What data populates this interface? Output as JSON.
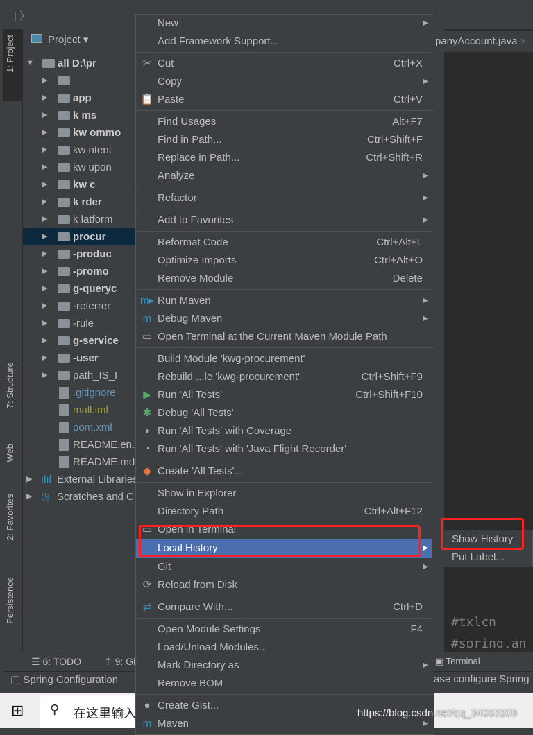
{
  "breadcrumb": "|  〉",
  "left_tabs": [
    "1: Project",
    "7: Structure",
    "Web",
    "2: Favorites",
    "Persistence"
  ],
  "project_header": "Project",
  "tree": [
    {
      "label": "all  D:\\pr",
      "expanded": true,
      "bold": true
    },
    {
      "label": "",
      "expanded": false
    },
    {
      "label": "app",
      "bold": true
    },
    {
      "label": "k    ms",
      "bold": true
    },
    {
      "label": "kw    ommo",
      "bold": true
    },
    {
      "label": "kw    ntent"
    },
    {
      "label": "kw    upon"
    },
    {
      "label": "kw    c",
      "bold": true
    },
    {
      "label": "k    rder",
      "bold": true
    },
    {
      "label": "k    latform"
    },
    {
      "label": "procur",
      "bold": true,
      "selected": true
    },
    {
      "label": "-produc",
      "bold": true
    },
    {
      "label": "-promo",
      "bold": true
    },
    {
      "label": "g-queryc",
      "bold": true
    },
    {
      "label": "-referrer"
    },
    {
      "label": "-rule"
    },
    {
      "label": "g-service",
      "bold": true
    },
    {
      "label": "-user",
      "bold": true
    },
    {
      "label": "path_IS_I"
    }
  ],
  "tree_files": [
    ".gitignore",
    "mall.iml",
    "pom.xml",
    "README.en.",
    "README.md"
  ],
  "external_libraries": "External Libraries",
  "scratches": "Scratches and C",
  "editor_tab": "panyAccount.java",
  "code_lines": [
    "#txlcn",
    "#spring.an"
  ],
  "bottom_tabs": [
    "6: TODO",
    "9: Gi",
    "Terminal"
  ],
  "status_left": "Spring Configuration",
  "status_right": "ase configure Spring",
  "taskbar_search": "在这里输入",
  "watermark": "https://blog.csdn.net/qq_34033209",
  "menu": [
    {
      "label": "New",
      "submenu": true
    },
    {
      "label": "Add Framework Support..."
    },
    {
      "sep": true
    },
    {
      "label": "Cut",
      "shortcut": "Ctrl+X",
      "icon": "scissors"
    },
    {
      "label": "Copy",
      "submenu": true
    },
    {
      "label": "Paste",
      "shortcut": "Ctrl+V",
      "icon": "clipboard"
    },
    {
      "sep": true
    },
    {
      "label": "Find Usages",
      "shortcut": "Alt+F7"
    },
    {
      "label": "Find in Path...",
      "shortcut": "Ctrl+Shift+F"
    },
    {
      "label": "Replace in Path...",
      "shortcut": "Ctrl+Shift+R"
    },
    {
      "label": "Analyze",
      "submenu": true
    },
    {
      "sep": true
    },
    {
      "label": "Refactor",
      "submenu": true
    },
    {
      "sep": true
    },
    {
      "label": "Add to Favorites",
      "submenu": true
    },
    {
      "sep": true
    },
    {
      "label": "Reformat Code",
      "shortcut": "Ctrl+Alt+L"
    },
    {
      "label": "Optimize Imports",
      "shortcut": "Ctrl+Alt+O"
    },
    {
      "label": "Remove Module",
      "shortcut": "Delete"
    },
    {
      "sep": true
    },
    {
      "label": "Run Maven",
      "submenu": true,
      "icon": "maven-run"
    },
    {
      "label": "Debug Maven",
      "submenu": true,
      "icon": "maven-debug"
    },
    {
      "label": "Open Terminal at the Current Maven Module Path",
      "icon": "maven-terminal"
    },
    {
      "sep": true
    },
    {
      "label": "Build Module 'kwg-procurement'"
    },
    {
      "label": "Rebuild ...le 'kwg-procurement'",
      "shortcut": "Ctrl+Shift+F9"
    },
    {
      "label": "Run 'All Tests'",
      "shortcut": "Ctrl+Shift+F10",
      "icon": "run"
    },
    {
      "label": "Debug 'All Tests'",
      "icon": "debug"
    },
    {
      "label": "Run 'All Tests' with Coverage",
      "icon": "coverage"
    },
    {
      "label": "Run 'All Tests' with 'Java Flight Recorder'",
      "icon": "profiler"
    },
    {
      "sep": true
    },
    {
      "label": "Create 'All Tests'...",
      "icon": "create-test"
    },
    {
      "sep": true
    },
    {
      "label": "Show in Explorer"
    },
    {
      "label": "Directory Path",
      "shortcut": "Ctrl+Alt+F12"
    },
    {
      "label": "Open in Terminal",
      "icon": "terminal"
    },
    {
      "label": "Local History",
      "submenu": true,
      "highlighted": true
    },
    {
      "label": "Git",
      "submenu": true
    },
    {
      "label": "Reload from Disk",
      "icon": "reload"
    },
    {
      "sep": true
    },
    {
      "label": "Compare With...",
      "shortcut": "Ctrl+D",
      "icon": "compare"
    },
    {
      "sep": true
    },
    {
      "label": "Open Module Settings",
      "shortcut": "F4"
    },
    {
      "label": "Load/Unload Modules..."
    },
    {
      "label": "Mark Directory as",
      "submenu": true
    },
    {
      "label": "Remove BOM"
    },
    {
      "sep": true
    },
    {
      "label": "Create Gist...",
      "icon": "github"
    },
    {
      "label": "Maven",
      "submenu": true,
      "icon": "maven"
    }
  ],
  "submenu": [
    {
      "label": "Show History"
    },
    {
      "label": "Put Label..."
    }
  ],
  "colors": {
    "highlight": "#4b6eaf",
    "annotation": "#ff2020",
    "bg": "#3c3f41"
  }
}
